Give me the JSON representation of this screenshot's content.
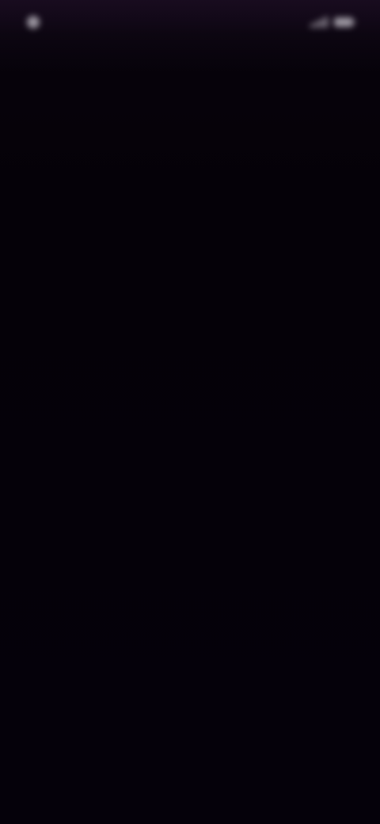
{
  "status_bar": {
    "left_text": "",
    "right_text": "",
    "icons": [
      "signal-icon",
      "battery-icon"
    ]
  },
  "hero": {
    "title": "",
    "subtitle": ""
  },
  "colors": {
    "background": "#050108",
    "title": "#ddd9e1",
    "status_tint": "#120818"
  }
}
